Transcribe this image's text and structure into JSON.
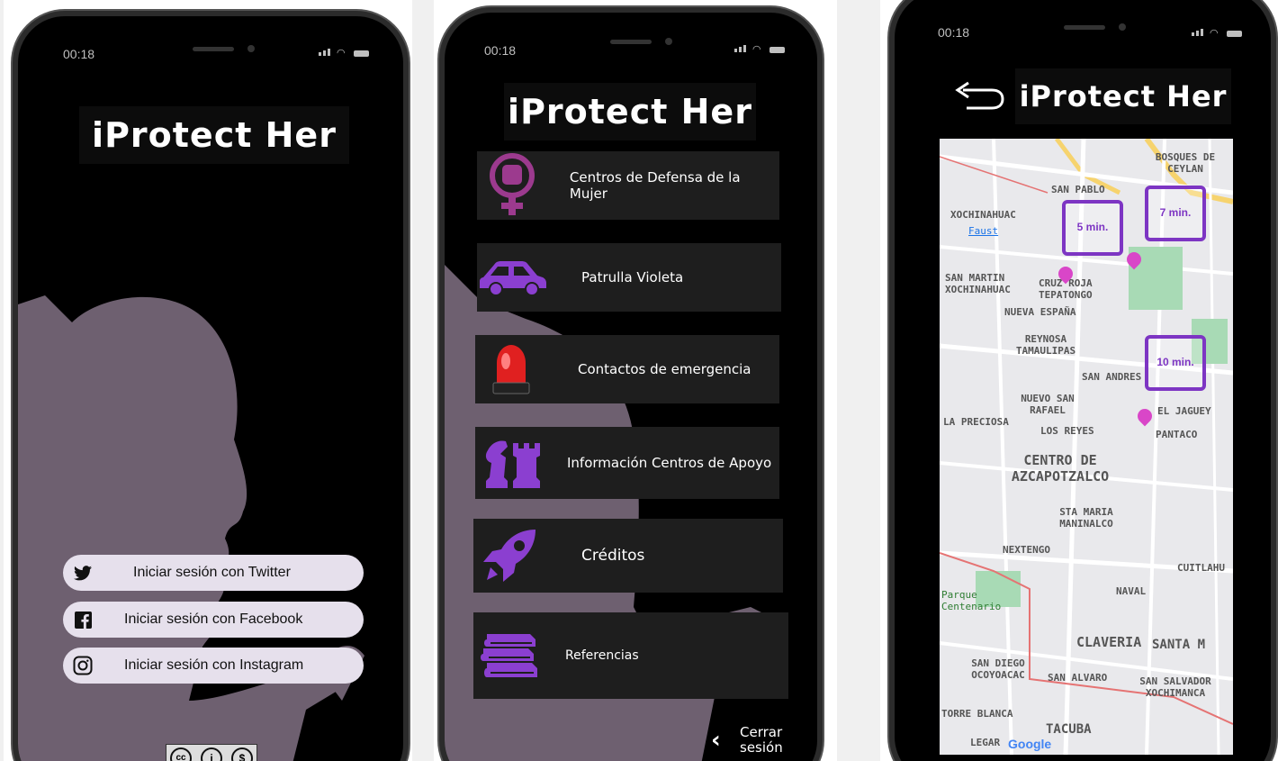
{
  "screens": [
    {
      "status_time": "00:18",
      "app_title": "iProtect Her",
      "login_buttons": [
        {
          "label": "Iniciar sesión con Twitter",
          "icon": "twitter-icon"
        },
        {
          "label": "Iniciar sesión con Facebook",
          "icon": "facebook-icon"
        },
        {
          "label": "Iniciar sesión con Instagram",
          "icon": "instagram-icon"
        }
      ],
      "license_badge": "cc-by-nc-icon"
    },
    {
      "status_time": "00:18",
      "app_title": "iProtect Her",
      "menu_items": [
        {
          "label": "Centros de Defensa de la Mujer",
          "icon": "feminist-fist-icon"
        },
        {
          "label": "Patrulla Violeta",
          "icon": "car-icon"
        },
        {
          "label": "Contactos de emergencia",
          "icon": "siren-icon"
        },
        {
          "label": "Información Centros de Apoyo",
          "icon": "chess-pieces-icon"
        },
        {
          "label": "Créditos",
          "icon": "rocket-icon"
        },
        {
          "label": "Referencias",
          "icon": "books-icon"
        }
      ],
      "logout": {
        "line1": "Cerrar",
        "line2": "sesión"
      }
    },
    {
      "status_time": "00:18",
      "app_title": "iProtect Her",
      "map": {
        "labels": [
          "BOSQUES DE CEYLAN",
          "SAN PABLO",
          "XOCHINAHUAC",
          "Faust",
          "SAN MARTIN XOCHINAHUAC",
          "CRUZ ROJA TEPATONGO",
          "NUEVA ESPAÑA",
          "REYNOSA TAMAULIPAS",
          "SAN ANDRES",
          "NUEVO SAN RAFAEL",
          "LA PRECIOSA",
          "LOS REYES",
          "EL JAGUEY",
          "PANTACO",
          "CENTRO DE AZCAPOTZALCO",
          "STA MARIA MANINALCO",
          "NEXTENGO",
          "CUITLAHU",
          "NAVAL",
          "CLAVERIA",
          "SANTA M",
          "SAN DIEGO OCOYOACAC",
          "SAN ALVARO",
          "SAN SALVADOR XOCHIMANCA",
          "TORRE BLANCA",
          "TACUBA",
          "LEGAR",
          "Parque Centenario",
          "Google"
        ],
        "time_bubbles": [
          "5 min.",
          "7 min.",
          "10 min."
        ]
      }
    }
  ],
  "colors": {
    "accent_purple": "#7d35c3",
    "silhouette": "#6e6070",
    "button_bg": "#e6e0ec",
    "menu_bg": "#1e1e1e"
  }
}
